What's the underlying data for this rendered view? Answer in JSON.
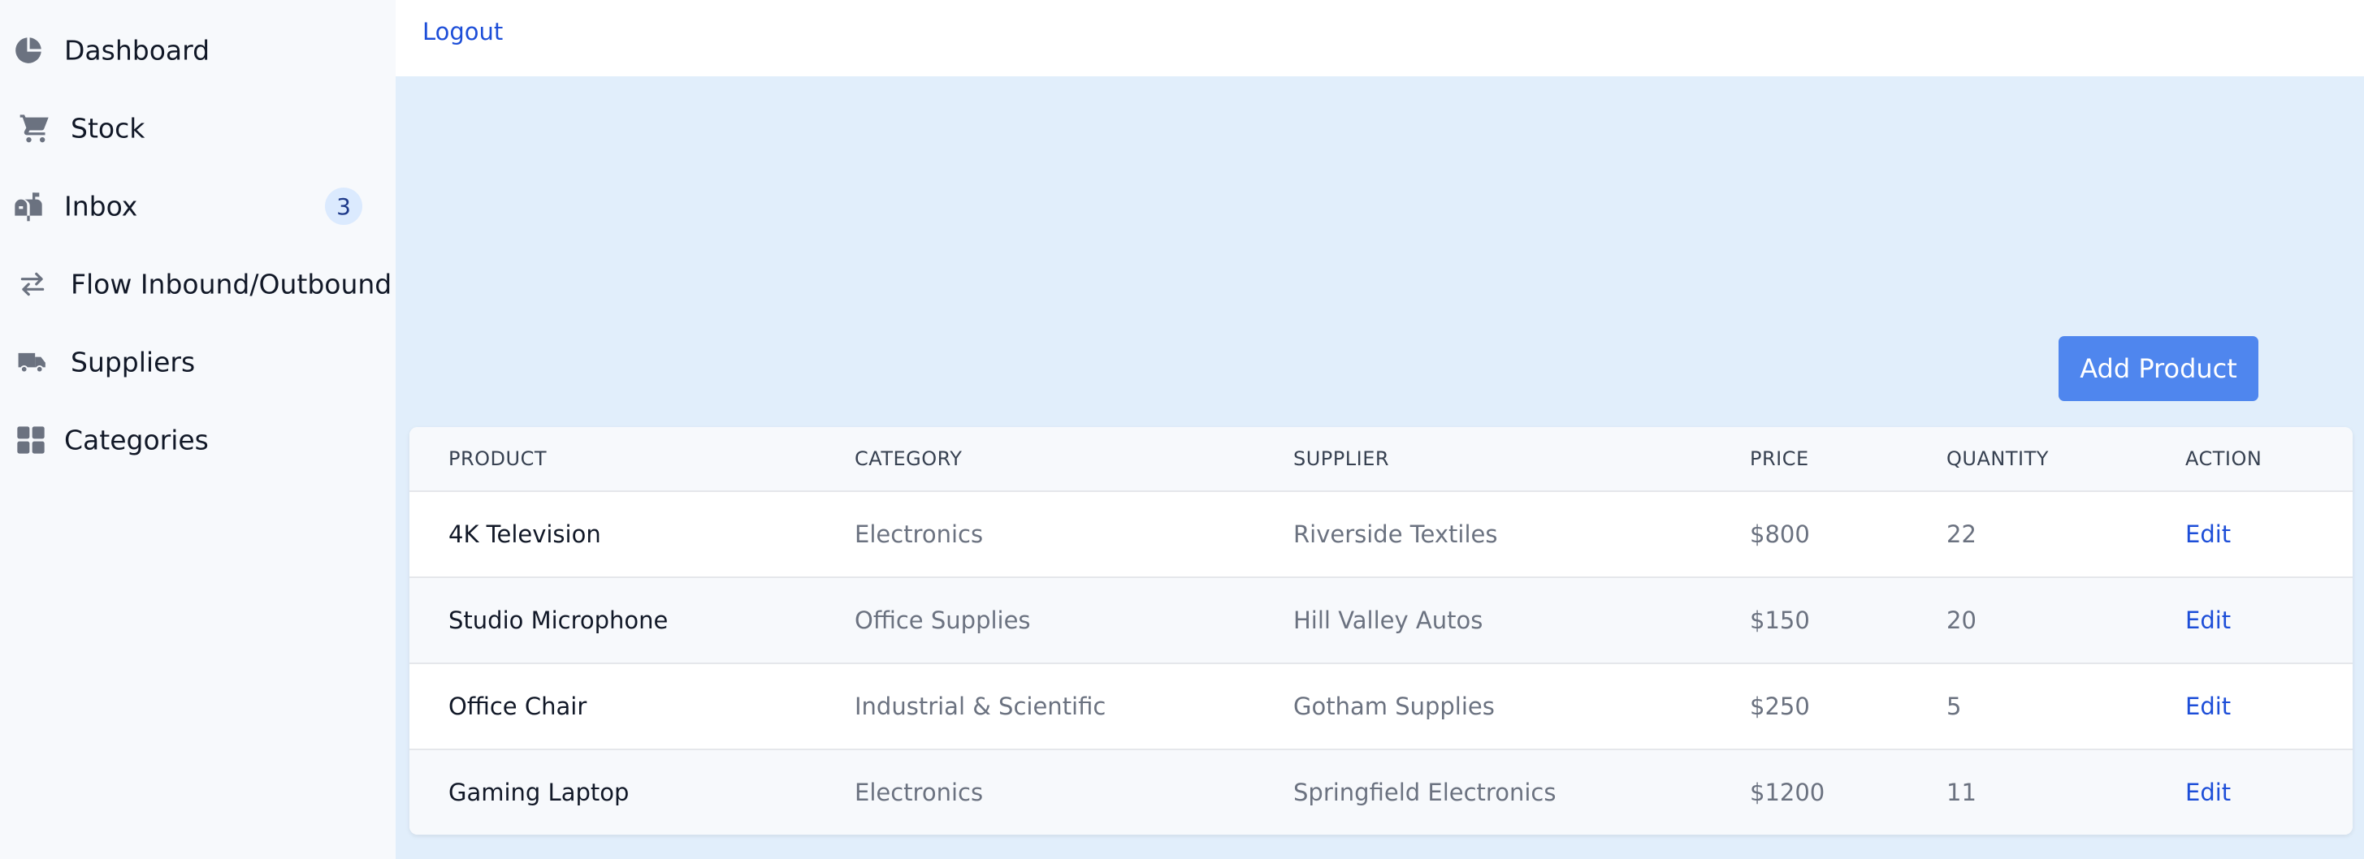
{
  "sidebar": {
    "items": [
      {
        "label": "Dashboard",
        "icon": "pie-chart-icon"
      },
      {
        "label": "Stock",
        "icon": "cart-icon"
      },
      {
        "label": "Inbox",
        "icon": "mailbox-icon",
        "badge": "3"
      },
      {
        "label": "Flow Inbound/Outbound",
        "icon": "arrows-exchange-icon"
      },
      {
        "label": "Suppliers",
        "icon": "truck-icon"
      },
      {
        "label": "Categories",
        "icon": "grid-icon"
      }
    ]
  },
  "topbar": {
    "logout_label": "Logout"
  },
  "main": {
    "add_product_label": "Add Product",
    "table": {
      "headers": [
        "PRODUCT",
        "CATEGORY",
        "SUPPLIER",
        "PRICE",
        "QUANTITY",
        "ACTION"
      ],
      "rows": [
        {
          "product": "4K Television",
          "category": "Electronics",
          "supplier": "Riverside Textiles",
          "price": "$800",
          "quantity": "22",
          "action": "Edit"
        },
        {
          "product": "Studio Microphone",
          "category": "Office Supplies",
          "supplier": "Hill Valley Autos",
          "price": "$150",
          "quantity": "20",
          "action": "Edit"
        },
        {
          "product": "Office Chair",
          "category": "Industrial & Scientific",
          "supplier": "Gotham Supplies",
          "price": "$250",
          "quantity": "5",
          "action": "Edit"
        },
        {
          "product": "Gaming Laptop",
          "category": "Electronics",
          "supplier": "Springfield Electronics",
          "price": "$1200",
          "quantity": "11",
          "action": "Edit"
        }
      ]
    }
  },
  "colors": {
    "sidebar_bg": "#f7f9fc",
    "main_bg": "#e1eefb",
    "accent": "#4f86ee",
    "link": "#1d4ed8",
    "icon": "#6b7280",
    "badge_bg": "#dbeafe"
  }
}
